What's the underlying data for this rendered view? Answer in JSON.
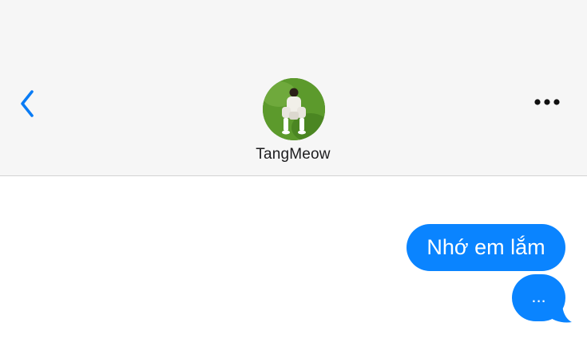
{
  "header": {
    "contact_name": "TangMeow",
    "back_icon": "chevron-left-icon",
    "more_icon": "ellipsis-icon",
    "avatar_icon": "contact-photo"
  },
  "messages": [
    {
      "direction": "outgoing",
      "text": "Nhớ em lắm"
    },
    {
      "direction": "outgoing",
      "text": "..."
    }
  ],
  "colors": {
    "accent": "#0a84ff",
    "bubble_outgoing": "#0a84ff",
    "header_bg": "#f6f6f6",
    "chat_bg": "#ffffff"
  }
}
